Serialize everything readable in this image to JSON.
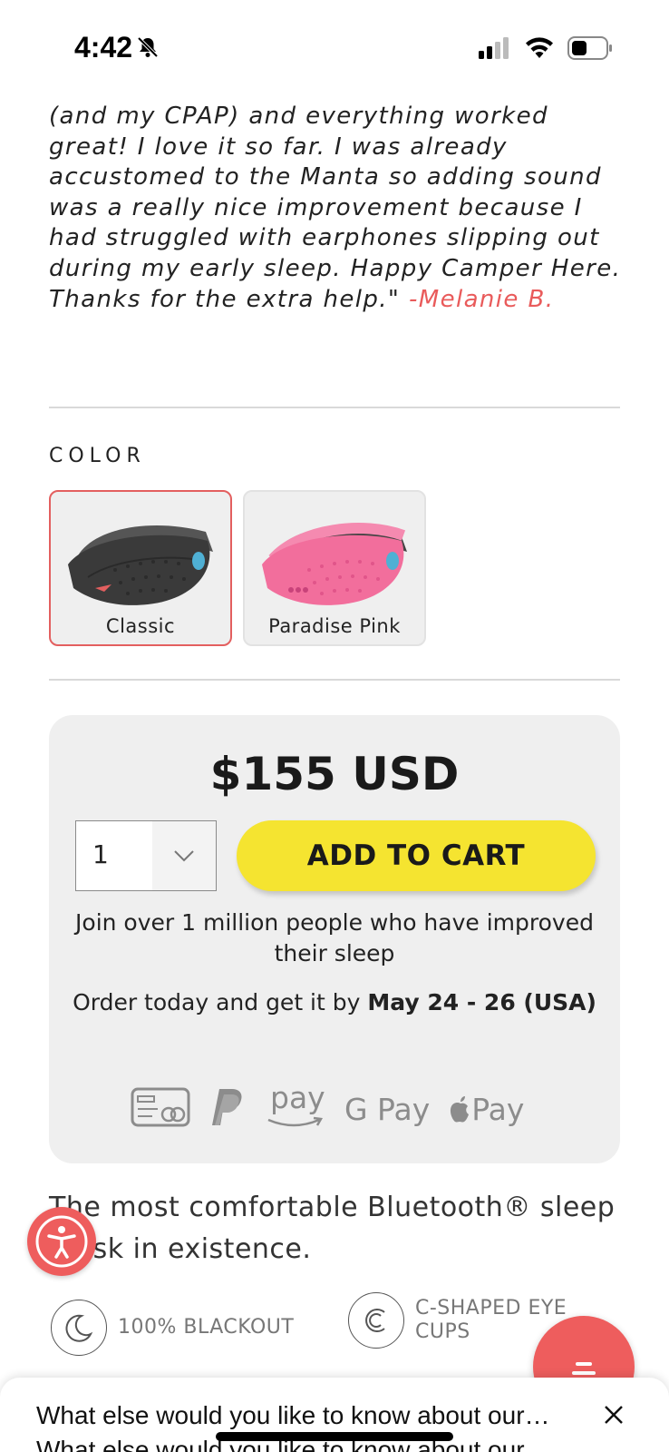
{
  "status_bar": {
    "time": "4:42"
  },
  "review": {
    "text": "(and my CPAP) and everything worked great! I love it so far. I was already accustomed to the Manta so adding sound was a really nice improvement because I had struggled with earphones slipping out during my early sleep. Happy Camper Here. Thanks for the extra help.\"",
    "author": "-Melanie B."
  },
  "color_picker": {
    "title": "COLOR",
    "options": [
      {
        "label": "Classic",
        "selected": true,
        "mask_color": "#3a3a3a"
      },
      {
        "label": "Paradise Pink",
        "selected": false,
        "mask_color": "#f26e9c"
      }
    ]
  },
  "buy_box": {
    "price": "$155 USD",
    "quantity": "1",
    "add_to_cart_label": "ADD TO CART",
    "join_text": "Join over 1 million people who have improved their sleep",
    "order_prefix": "Order today and get it by ",
    "order_dates": "May 24 - 26 (USA)",
    "payment_methods": [
      "card-icon",
      "paypal-icon",
      "amazon-pay-icon",
      "google-pay-icon",
      "apple-pay-icon"
    ],
    "amazon_pay_label": "pay",
    "google_pay_label": "G Pay",
    "apple_pay_label": "Pay"
  },
  "tagline": "The most comfortable Bluetooth® sleep mask in existence.",
  "features": [
    {
      "icon": "moon-icon",
      "label": "100% BLACKOUT"
    },
    {
      "icon": "c-shape-icon",
      "label": "C-SHAPED EYE CUPS"
    }
  ],
  "chat": {
    "question": "What else would you like to know about our…",
    "question_ghost": "What else would you like to know about our"
  },
  "colors": {
    "accent_red": "#ee5d5d",
    "cart_yellow": "#f5e430",
    "buy_box_bg": "#efefef"
  }
}
